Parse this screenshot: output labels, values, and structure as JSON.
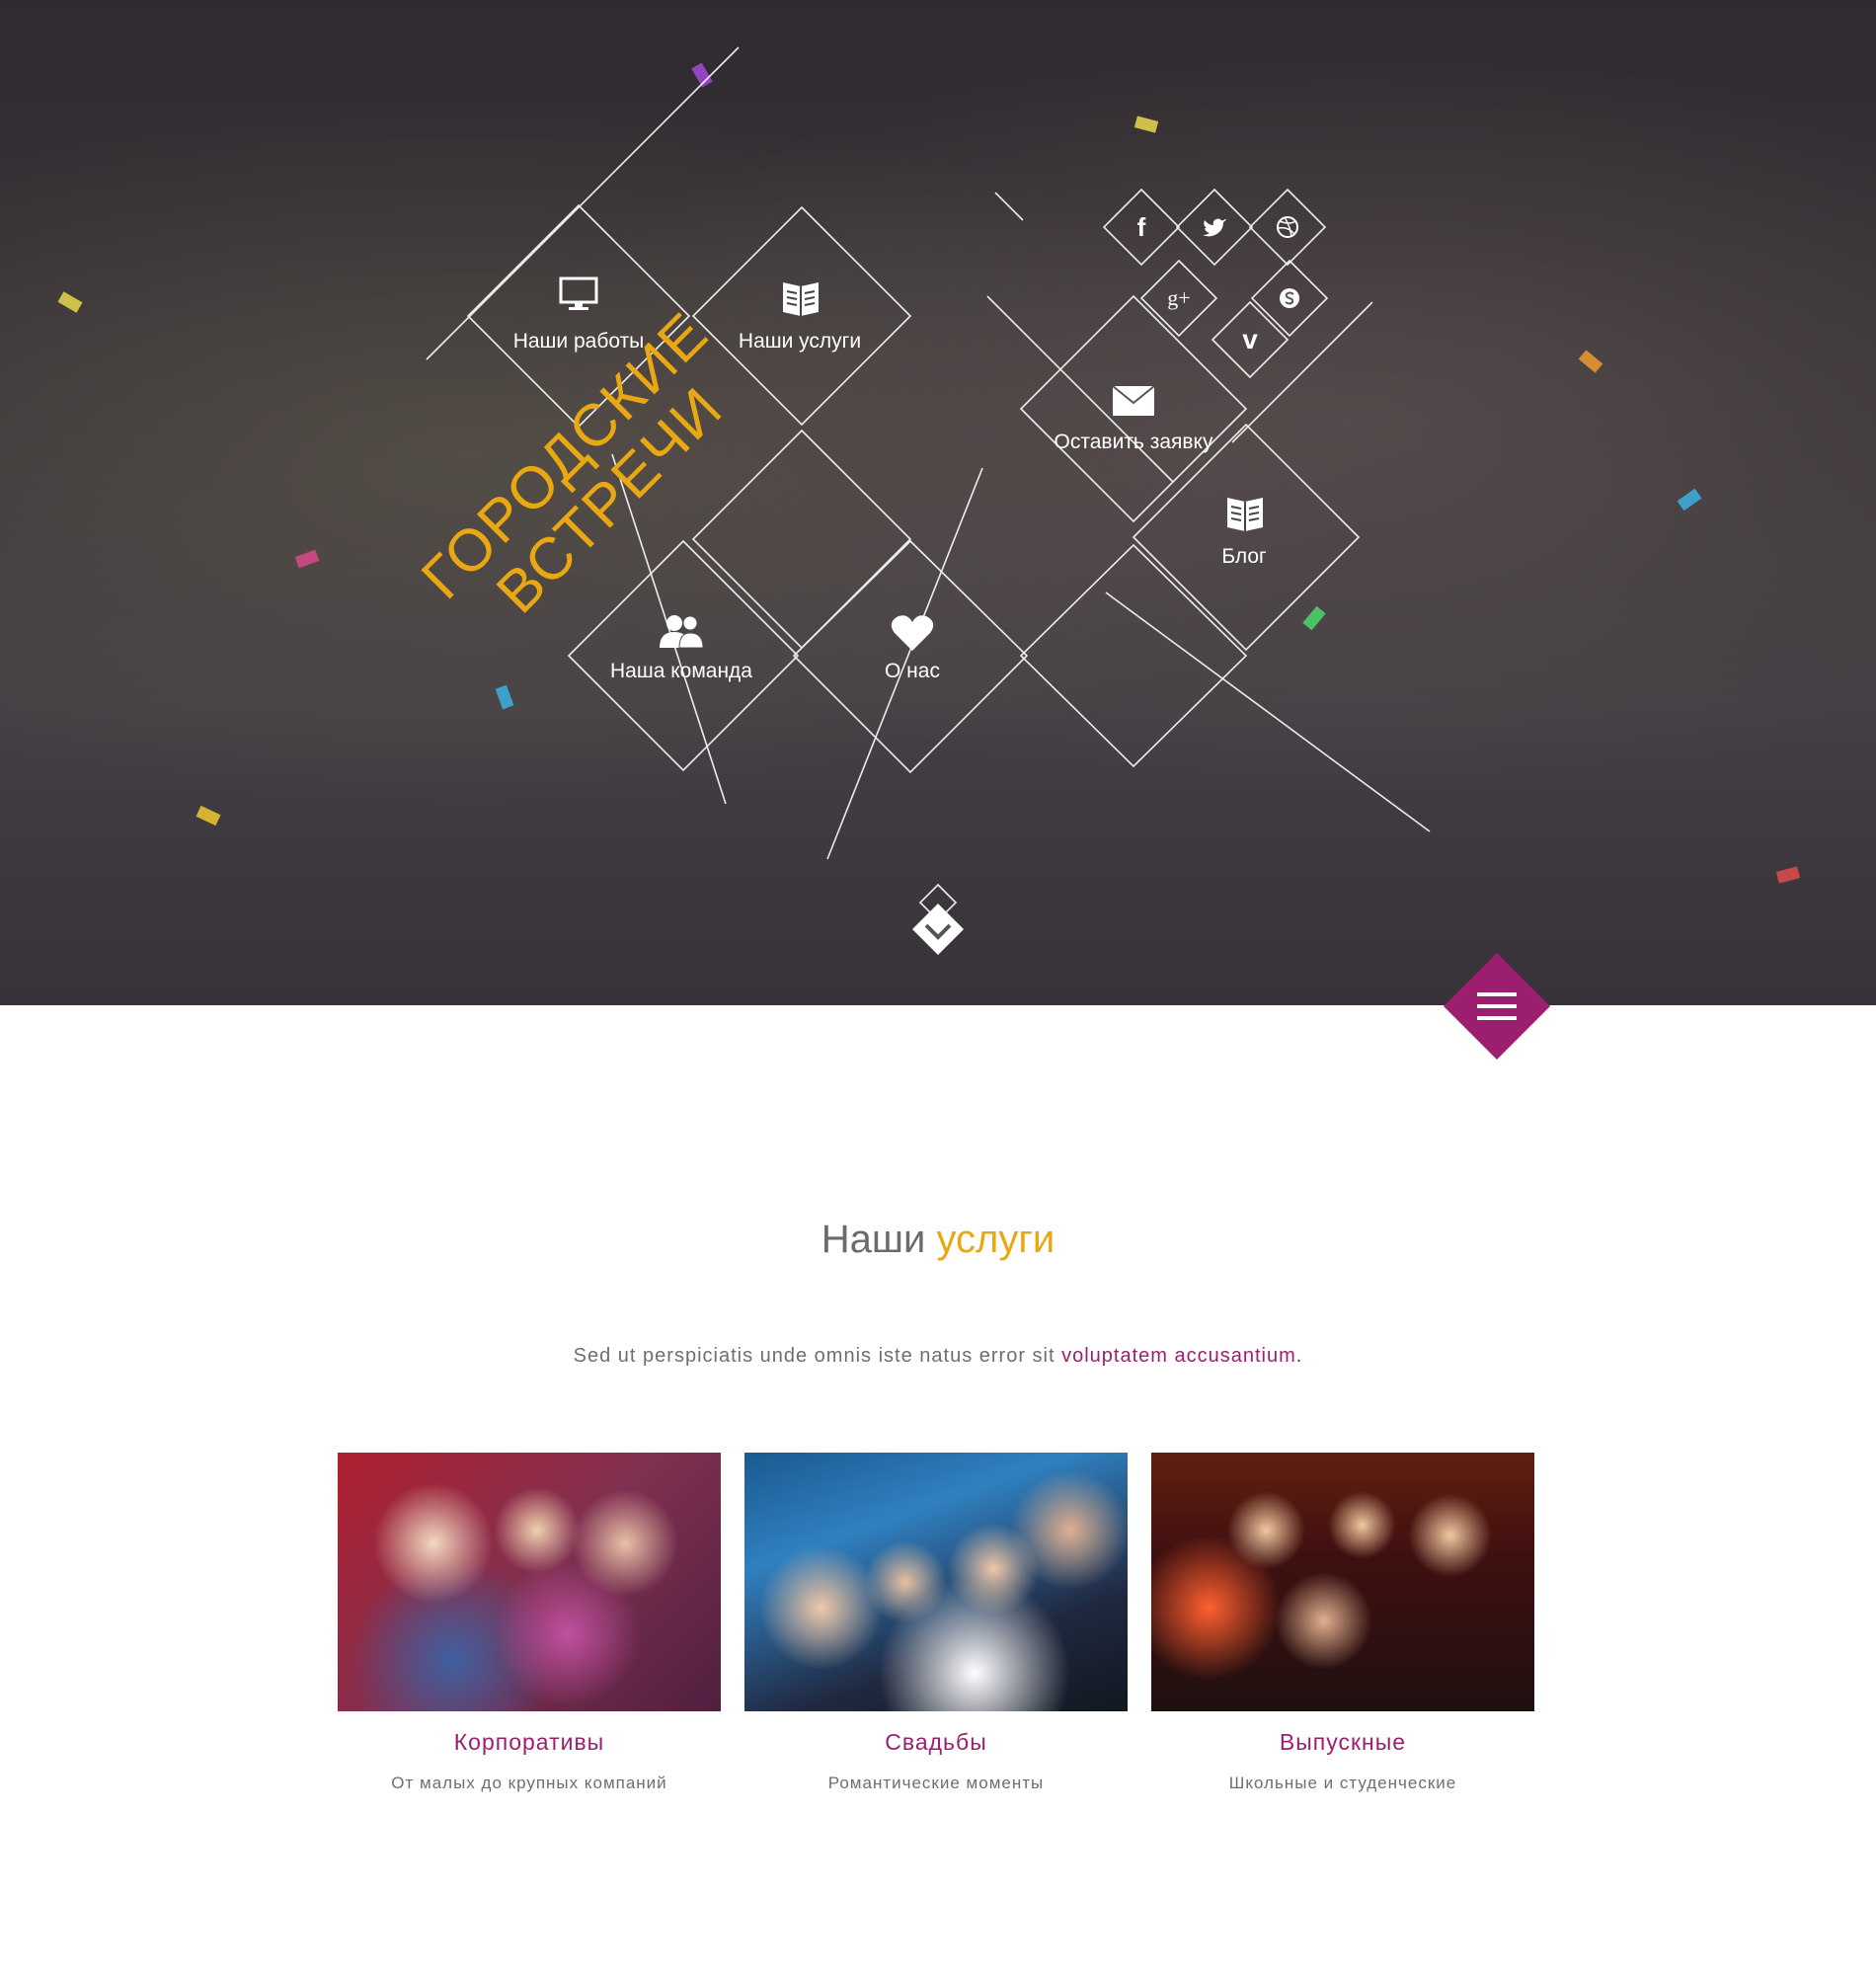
{
  "brand": {
    "logo_line1": "ГОРОДСКИЕ",
    "logo_line2": "ВСТРЕЧИ",
    "accent_color": "#e8a713",
    "secondary_color": "#9b1f6e"
  },
  "nav": {
    "items": [
      {
        "label": "Наши работы",
        "icon": "monitor-icon"
      },
      {
        "label": "Наши услуги",
        "icon": "book-icon"
      },
      {
        "label": "Оставить заявку",
        "icon": "envelope-icon"
      },
      {
        "label": "Блог",
        "icon": "book-icon"
      },
      {
        "label": "Наша команда",
        "icon": "users-icon"
      },
      {
        "label": "О нас",
        "icon": "heart-icon"
      }
    ]
  },
  "social": {
    "facebook": "f",
    "twitter": "twitter-icon",
    "dribbble": "dribbble-icon",
    "google_plus": "g+",
    "skype": "skype-icon",
    "vimeo": "v"
  },
  "services": {
    "title_plain": "Наши",
    "title_accent": "услуги",
    "subtitle_plain": "Sed ut perspiciatis unde omnis iste natus error sit",
    "subtitle_accent": "voluptatem accusantium.",
    "cards": [
      {
        "title": "Корпоративы",
        "desc": "От малых до крупных компаний"
      },
      {
        "title": "Свадьбы",
        "desc": "Романтические моменты"
      },
      {
        "title": "Выпускные",
        "desc": "Школьные и студенческие"
      }
    ]
  }
}
